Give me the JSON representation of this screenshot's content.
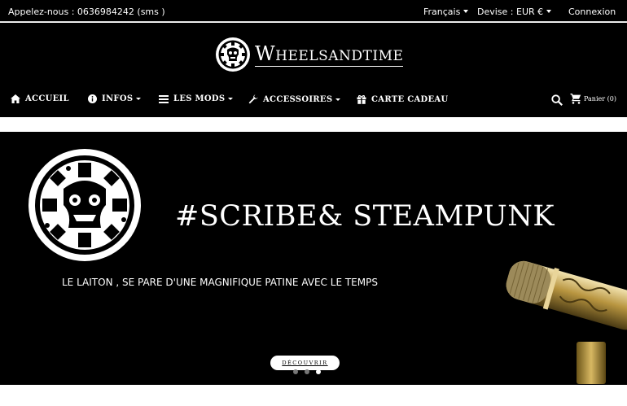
{
  "topbar": {
    "phone": "Appelez-nous : 0636984242 (sms )",
    "language": "Français",
    "currency": "Devise : EUR €",
    "login": "Connexion"
  },
  "logo": {
    "first": "W",
    "rest": "HEELSANDTIME"
  },
  "nav": {
    "items": [
      {
        "label": "ACCUEIL",
        "icon": "home-icon"
      },
      {
        "label": "INFOS",
        "icon": "info-icon",
        "dropdown": true
      },
      {
        "label": "LES MODS",
        "icon": "list-icon",
        "dropdown": true
      },
      {
        "label": "ACCESSOIRES",
        "icon": "wrench-icon",
        "dropdown": true
      },
      {
        "label": "CARTE CADEAU",
        "icon": "gift-icon"
      }
    ],
    "cart_label": "Panier",
    "cart_count": "(0)"
  },
  "hero": {
    "title": "#SCRIBE& STEAMPUNK",
    "subtitle": "LE LAITON , SE PARE D'UNE MAGNIFIQUE PATINE AVEC LE TEMPS",
    "button": "DÉCOUVRIR",
    "slides": 3,
    "active_slide": 3
  },
  "colors": {
    "background": "#000000",
    "text": "#ffffff",
    "accent": "#c9a24a"
  }
}
